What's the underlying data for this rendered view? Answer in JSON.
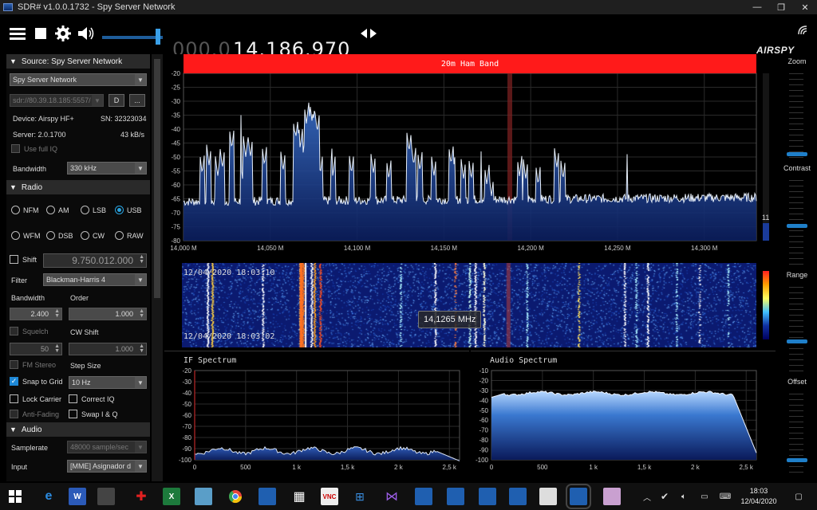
{
  "window": {
    "title": "SDR# v1.0.0.1732 - Spy Server Network",
    "controls": [
      "—",
      "❐",
      "✕"
    ]
  },
  "toolbar": {
    "freq_dim": "000.0",
    "freq_bright": "14.186.970",
    "logo": "AIRSPY",
    "icons": [
      "menu-icon",
      "stop-icon",
      "gear-icon",
      "speaker-icon",
      "tune-arrows-icon"
    ],
    "volume_level": 0.9
  },
  "source": {
    "header": "Source: Spy Server Network",
    "type": "Spy Server Network",
    "uri": "sdr://80.39.18.185:5557/",
    "d_btn": "D",
    "more_btn": "...",
    "device": "Device: Airspy HF+",
    "sn": "SN: 32323034",
    "server": "Server: 2.0.1700",
    "rate": "43 kB/s",
    "full_iq": "Use full IQ",
    "bandwidth_label": "Bandwidth",
    "bandwidth": "330 kHz"
  },
  "radio": {
    "header": "Radio",
    "modes_row1": [
      "NFM",
      "AM",
      "LSB",
      "USB"
    ],
    "modes_row2": [
      "WFM",
      "DSB",
      "CW",
      "RAW"
    ],
    "selected_mode": "USB",
    "shift_label": "Shift",
    "shift_value": "9.750.012.000",
    "filter_label": "Filter",
    "filter": "Blackman-Harris 4",
    "bandwidth_label": "Bandwidth",
    "order_label": "Order",
    "bandwidth": "2.400",
    "order": "1.000",
    "squelch_label": "Squelch",
    "cw_shift_label": "CW Shift",
    "squelch": "50",
    "cw_shift": "1.000",
    "fm_stereo": "FM Stereo",
    "step_size_label": "Step Size",
    "snap_to_grid": "Snap to Grid",
    "step_size": "10 Hz",
    "lock_carrier": "Lock Carrier",
    "correct_iq": "Correct IQ",
    "anti_fading": "Anti-Fading",
    "swap_iq": "Swap I & Q"
  },
  "audio": {
    "header": "Audio",
    "samplerate_label": "Samplerate",
    "samplerate": "48000 sample/sec",
    "input_label": "Input",
    "input": "[MME] Asignador d"
  },
  "spectrum": {
    "band_label": "20m Ham Band",
    "y_ticks": [
      "-20",
      "-25",
      "-30",
      "-35",
      "-40",
      "-45",
      "-50",
      "-55",
      "-60",
      "-65",
      "-70",
      "-75",
      "-80"
    ],
    "x_ticks": [
      "14,000 M",
      "14,050 M",
      "14,100 M",
      "14,150 M",
      "14,200 M",
      "14,250 M",
      "14,300 M"
    ],
    "scale_readout": "11"
  },
  "waterfall": {
    "time_top": "12/04/2020 18:03:10",
    "time_bottom": "12/04/2020 18:03:02",
    "tooltip": "14,1265 MHz"
  },
  "if_spectrum": {
    "title": "IF Spectrum",
    "y_ticks": [
      "-20",
      "-30",
      "-40",
      "-50",
      "-60",
      "-70",
      "-80",
      "-90",
      "-100"
    ],
    "x_ticks": [
      "0",
      "500",
      "1 k",
      "1,5 k",
      "2 k",
      "2,5 k"
    ]
  },
  "audio_spectrum": {
    "title": "Audio Spectrum",
    "y_ticks": [
      "-10",
      "-20",
      "-30",
      "-40",
      "-50",
      "-60",
      "-70",
      "-80",
      "-90",
      "-100"
    ],
    "x_ticks": [
      "0",
      "500",
      "1 k",
      "1,5 k",
      "2 k",
      "2,5 k"
    ]
  },
  "right_controls": {
    "zoom": "Zoom",
    "contrast": "Contrast",
    "range": "Range",
    "offset": "Offset"
  },
  "taskbar": {
    "time": "18:03",
    "date": "12/04/2020"
  }
}
